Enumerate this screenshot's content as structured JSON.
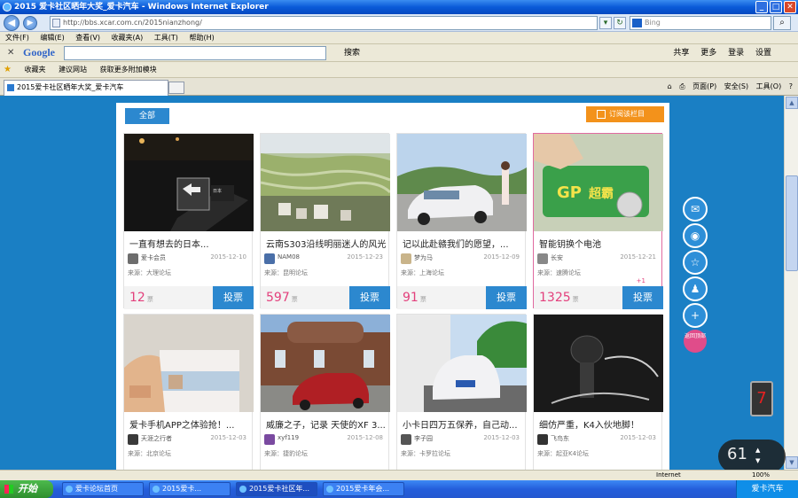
{
  "window": {
    "title": "2015 爱卡社区晒年大奖_爱卡汽车 - Windows Internet Explorer",
    "url": "http://bbs.xcar.com.cn/2015nianzhong/",
    "search_placeholder": "Bing"
  },
  "menu": [
    "文件(F)",
    "编辑(E)",
    "查看(V)",
    "收藏夹(A)",
    "工具(T)",
    "帮助(H)"
  ],
  "google_bar": {
    "logo": "Google",
    "search_label": "搜索",
    "right_items": [
      "共享",
      "更多",
      "登录",
      "设置"
    ]
  },
  "favorites_bar": {
    "favorites": "收藏夹",
    "item1": "建议网站",
    "item2": "获取更多附加模块"
  },
  "tab": {
    "label": "2015爱卡社区晒年大奖_爱卡汽车"
  },
  "command_bar": [
    "页面(P)",
    "安全(S)",
    "工具(O)"
  ],
  "content": {
    "all_button": "全部",
    "subscribe_button": "订阅该栏目",
    "vote_label": "投票",
    "vote_unit": "票",
    "plus_one": "+1",
    "cards": [
      {
        "title": "一直有想去的日本...",
        "user": "爱卡会员",
        "date": "2015-12-10",
        "source": "来源：大理论坛",
        "votes": "12"
      },
      {
        "title": "云南S303沿线明丽迷人的风光",
        "user": "NAM08",
        "date": "2015-12-23",
        "source": "来源：昆明论坛",
        "votes": "597"
      },
      {
        "title": "记以此赴赣我们的愿望，...",
        "user": "梦为马",
        "date": "2015-12-09",
        "source": "来源：上海论坛",
        "votes": "91"
      },
      {
        "title": "智能钥换个电池",
        "user": "长安",
        "date": "2015-12-21",
        "source": "来源：速腾论坛",
        "votes": "1325"
      },
      {
        "title": "爱卡手机APP之体验抢！...",
        "user": "天涯之行者",
        "date": "2015-12-03",
        "source": "来源：北京论坛",
        "votes": ""
      },
      {
        "title": "威廉之子，记录 天使的XF 3...",
        "user": "xyf119",
        "date": "2015-12-08",
        "source": "来源：捷豹论坛",
        "votes": ""
      },
      {
        "title": "小卡日四万五保养，自己动...",
        "user": "李子园",
        "date": "2015-12-03",
        "source": "来源：卡罗拉论坛",
        "votes": ""
      },
      {
        "title": "细仿严重，K4入伙地脚！",
        "user": "飞鸟东",
        "date": "2015-12-03",
        "source": "来源：起亚K4论坛",
        "votes": ""
      }
    ]
  },
  "side": {
    "report": "返回顶部"
  },
  "widget": {
    "digit": "7",
    "gauge": "61"
  },
  "status": {
    "zone": "Internet",
    "zoom": "100%"
  },
  "taskbar": {
    "start": "开始",
    "tasks": [
      "爱卡论坛首页",
      "2015爱卡...",
      "2015爱卡社区年...",
      "2015爱卡年会..."
    ],
    "tray": "爱卡汽车"
  }
}
